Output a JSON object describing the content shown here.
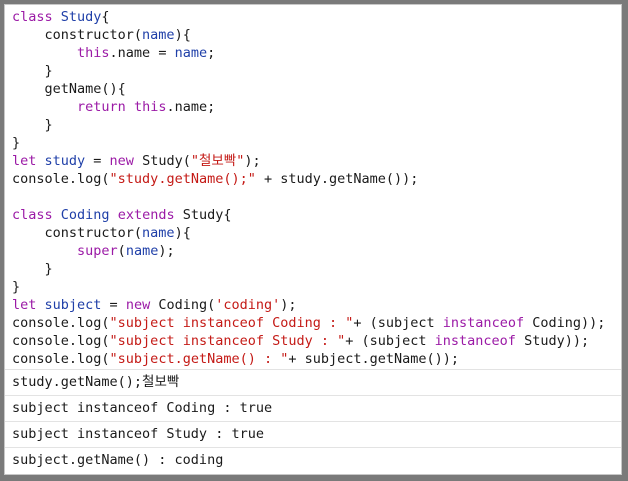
{
  "code_lines": [
    [
      {
        "t": "class ",
        "c": "kw"
      },
      {
        "t": "Study",
        "c": "cls"
      },
      {
        "t": "{"
      }
    ],
    [
      {
        "t": "    constructor("
      },
      {
        "t": "name",
        "c": "prm"
      },
      {
        "t": "){"
      }
    ],
    [
      {
        "t": "        "
      },
      {
        "t": "this",
        "c": "kw"
      },
      {
        "t": ".name = "
      },
      {
        "t": "name",
        "c": "prm"
      },
      {
        "t": ";"
      }
    ],
    [
      {
        "t": "    }"
      }
    ],
    [
      {
        "t": "    getName(){"
      }
    ],
    [
      {
        "t": "        "
      },
      {
        "t": "return",
        "c": "kw"
      },
      {
        "t": " "
      },
      {
        "t": "this",
        "c": "kw"
      },
      {
        "t": ".name;"
      }
    ],
    [
      {
        "t": "    }"
      }
    ],
    [
      {
        "t": "}"
      }
    ],
    [
      {
        "t": "let ",
        "c": "kw"
      },
      {
        "t": "study",
        "c": "prm"
      },
      {
        "t": " = "
      },
      {
        "t": "new",
        "c": "kw"
      },
      {
        "t": " Study("
      },
      {
        "t": "\"철보빡\"",
        "c": "str"
      },
      {
        "t": ");"
      }
    ],
    [
      {
        "t": "console.log("
      },
      {
        "t": "\"study.getName();\"",
        "c": "str"
      },
      {
        "t": " + study.getName());"
      }
    ],
    [
      {
        "t": ""
      }
    ],
    [
      {
        "t": "class ",
        "c": "kw"
      },
      {
        "t": "Coding",
        "c": "cls"
      },
      {
        "t": " "
      },
      {
        "t": "extends",
        "c": "kw"
      },
      {
        "t": " Study{"
      }
    ],
    [
      {
        "t": "    constructor("
      },
      {
        "t": "name",
        "c": "prm"
      },
      {
        "t": "){"
      }
    ],
    [
      {
        "t": "        "
      },
      {
        "t": "super",
        "c": "kw"
      },
      {
        "t": "("
      },
      {
        "t": "name",
        "c": "prm"
      },
      {
        "t": ");"
      }
    ],
    [
      {
        "t": "    }"
      }
    ],
    [
      {
        "t": "}"
      }
    ],
    [
      {
        "t": "let ",
        "c": "kw"
      },
      {
        "t": "subject",
        "c": "prm"
      },
      {
        "t": " = "
      },
      {
        "t": "new",
        "c": "kw"
      },
      {
        "t": " Coding("
      },
      {
        "t": "'coding'",
        "c": "str"
      },
      {
        "t": ");"
      }
    ],
    [
      {
        "t": "console.log("
      },
      {
        "t": "\"subject instanceof Coding : \"",
        "c": "str"
      },
      {
        "t": "+ (subject "
      },
      {
        "t": "instanceof",
        "c": "kw"
      },
      {
        "t": " Coding));"
      }
    ],
    [
      {
        "t": "console.log("
      },
      {
        "t": "\"subject instanceof Study : \"",
        "c": "str"
      },
      {
        "t": "+ (subject "
      },
      {
        "t": "instanceof",
        "c": "kw"
      },
      {
        "t": " Study));"
      }
    ],
    [
      {
        "t": "console.log("
      },
      {
        "t": "\"subject.getName() : \"",
        "c": "str"
      },
      {
        "t": "+ subject.getName());"
      }
    ]
  ],
  "output": [
    "study.getName();철보빡",
    "subject instanceof Coding : true",
    "subject instanceof Study : true",
    "subject.getName() : coding"
  ]
}
